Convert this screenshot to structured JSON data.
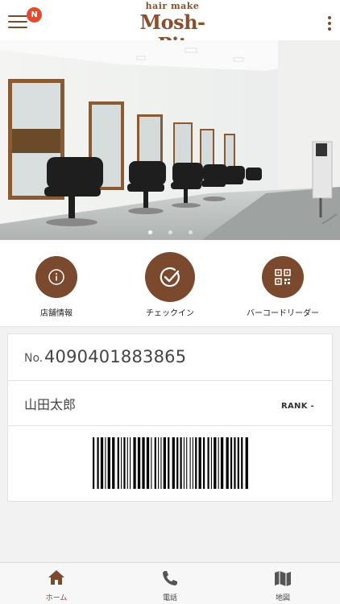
{
  "header": {
    "notification_badge": "N",
    "logo_small": "hair make",
    "logo_main": "Mosh-Pit"
  },
  "hero": {
    "slide_count": 3,
    "active_slide": 1
  },
  "actions": [
    {
      "label": "店舗情報",
      "icon": "info-icon"
    },
    {
      "label": "チェックイン",
      "icon": "checkmark-icon"
    },
    {
      "label": "バーコードリーダー",
      "icon": "qr-code-icon"
    }
  ],
  "member": {
    "no_prefix": "No.",
    "number": "4090401883865",
    "name": "山田太郎",
    "rank_label": "RANK",
    "rank_value": "-"
  },
  "tabs": [
    {
      "label": "ホーム",
      "icon": "home-icon",
      "active": true
    },
    {
      "label": "電話",
      "icon": "phone-icon",
      "active": false
    },
    {
      "label": "地図",
      "icon": "map-icon",
      "active": false
    }
  ],
  "colors": {
    "brand": "#7b4a2e",
    "badge": "#e44b2e",
    "background": "#f2f2f2"
  }
}
